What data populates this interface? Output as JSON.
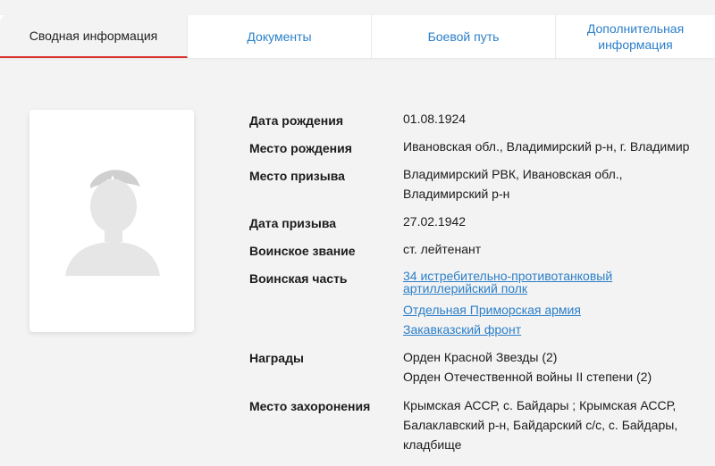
{
  "tabs": [
    {
      "label": "Сводная информация",
      "active": true
    },
    {
      "label": "Документы"
    },
    {
      "label": "Боевой путь"
    },
    {
      "label": "Дополнительная информация",
      "line1": "Дополнительная",
      "line2": "информация"
    }
  ],
  "profile": {
    "birth_date": {
      "label": "Дата рождения",
      "value": "01.08.1924"
    },
    "birth_place": {
      "label": "Место рождения",
      "value": "Ивановская обл., Владимирский р-н, г. Владимир"
    },
    "draft_place": {
      "label": "Место призыва",
      "line1": "Владимирский РВК, Ивановская обл.,",
      "line2": "Владимирский р-н"
    },
    "draft_date": {
      "label": "Дата призыва",
      "value": "27.02.1942"
    },
    "rank": {
      "label": "Воинское звание",
      "value": "ст. лейтенант"
    },
    "unit": {
      "label": "Воинская часть",
      "links": [
        {
          "line1": "34 истребительно-противотанковый",
          "line2": "артиллерийский полк"
        },
        {
          "text": "Отдельная Приморская армия"
        },
        {
          "text": "Закавказский фронт"
        }
      ]
    },
    "awards": {
      "label": "Награды",
      "items": [
        "Орден Красной Звезды (2)",
        "Орден Отечественной войны II степени (2)"
      ]
    },
    "burial": {
      "label": "Место захоронения",
      "line1": "Крымская АССР, с. Байдары ; Крымская АССР,",
      "line2": "Балаклавский р-н, Байдарский с/с, с. Байдары,",
      "line3": "кладбище"
    }
  },
  "colors": {
    "link": "#2b7fc9",
    "active_tab_underline": "#d9302c",
    "background": "#f3f3f3"
  },
  "icons": {
    "photo": "soldier-silhouette-icon"
  }
}
